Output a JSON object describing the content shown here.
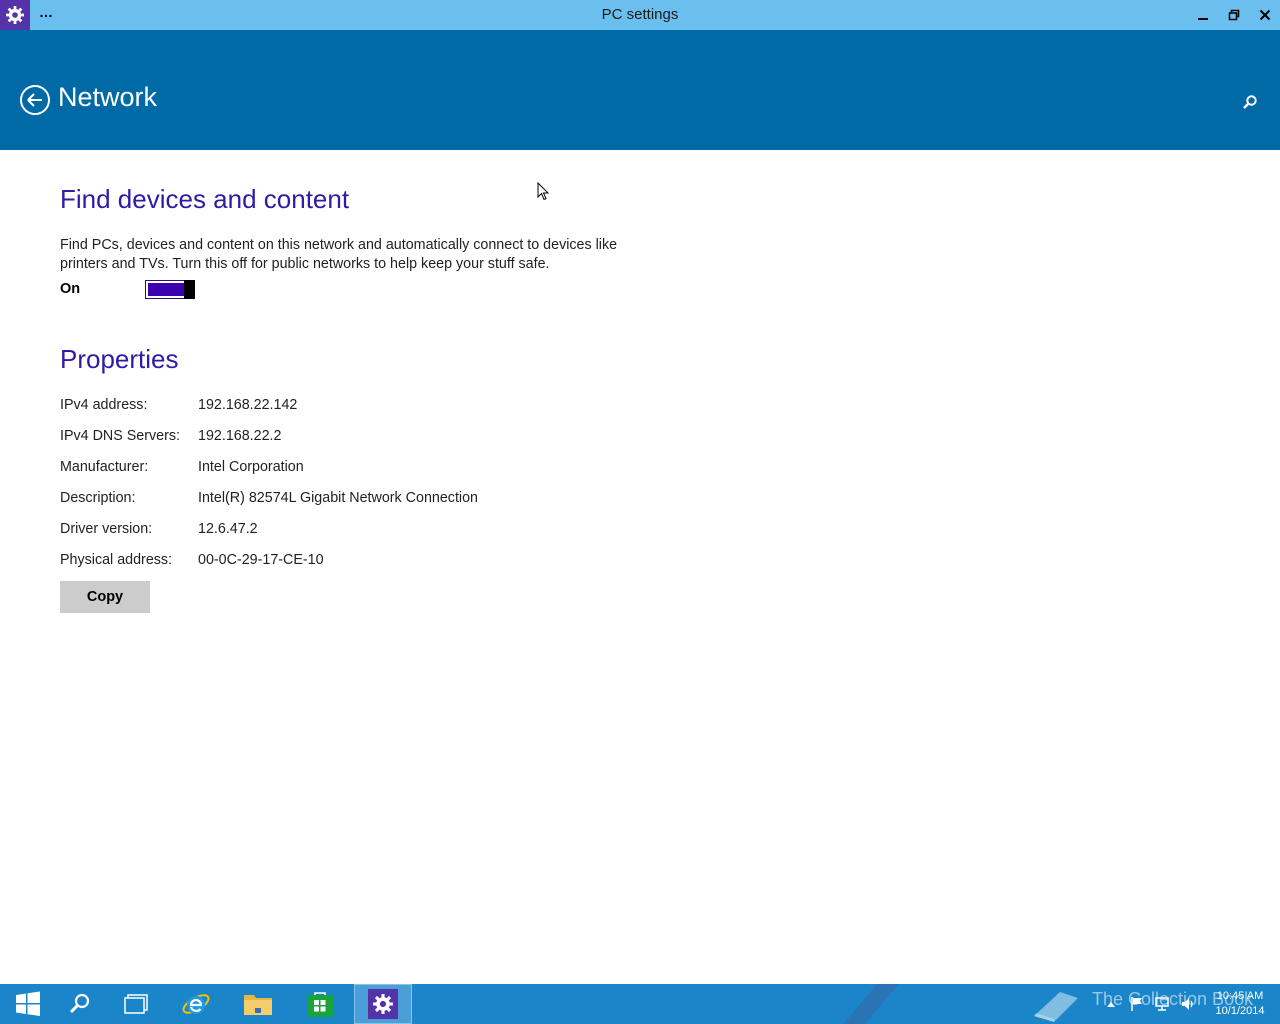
{
  "window": {
    "title": "PC settings",
    "menu_label": "…"
  },
  "header": {
    "title": "Network"
  },
  "find_devices": {
    "title": "Find devices and content",
    "description": "Find PCs, devices and content on this network and automatically connect to devices like printers and TVs. Turn this off for public networks to help keep your stuff safe.",
    "toggle_state_label": "On",
    "toggle_on": true
  },
  "properties": {
    "title": "Properties",
    "rows": [
      {
        "label": "IPv4 address:",
        "value": "192.168.22.142"
      },
      {
        "label": "IPv4 DNS Servers:",
        "value": "192.168.22.2"
      },
      {
        "label": "Manufacturer:",
        "value": "Intel Corporation"
      },
      {
        "label": "Description:",
        "value": "Intel(R) 82574L Gigabit Network Connection"
      },
      {
        "label": "Driver version:",
        "value": "12.6.47.2"
      },
      {
        "label": "Physical address:",
        "value": "00-0C-29-17-CE-10"
      }
    ],
    "copy_label": "Copy"
  },
  "taskbar": {
    "watermark": "The Collection Book",
    "clock_time": "10:45 AM",
    "clock_date": "10/1/2014"
  },
  "colors": {
    "title_bar": "#6bbfee",
    "header": "#006aa7",
    "accent_text": "#2e1ba6",
    "toggle_fill": "#3d00b0",
    "taskbar": "#1a86c9"
  }
}
